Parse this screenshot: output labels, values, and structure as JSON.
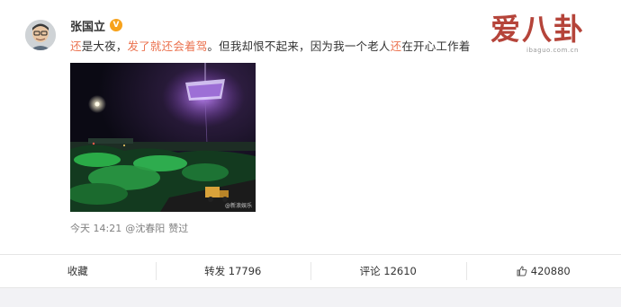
{
  "author": {
    "name": "张国立",
    "verified_badge": "V"
  },
  "post": {
    "text_1": "还",
    "text_2": "是大夜，",
    "text_3": "发了就还会着驾",
    "text_4": "。但我却恨不起来，因为我一个老人",
    "text_5": "还",
    "text_6": "在开心工作着"
  },
  "watermark": {
    "main": "爱八卦",
    "sub": "ibaguo.com.cn"
  },
  "photo": {
    "mark": "@新浪娱乐"
  },
  "meta": {
    "time": "今天 14:21",
    "by": "@沈春阳",
    "action": "赞过"
  },
  "actions": {
    "favorite": "收藏",
    "repost": "转发 17796",
    "comment": "评论 12610",
    "like_count": "420880"
  },
  "colors": {
    "highlight": "#eb7350",
    "badge": "#f7a21c",
    "watermark": "#b5443a"
  }
}
